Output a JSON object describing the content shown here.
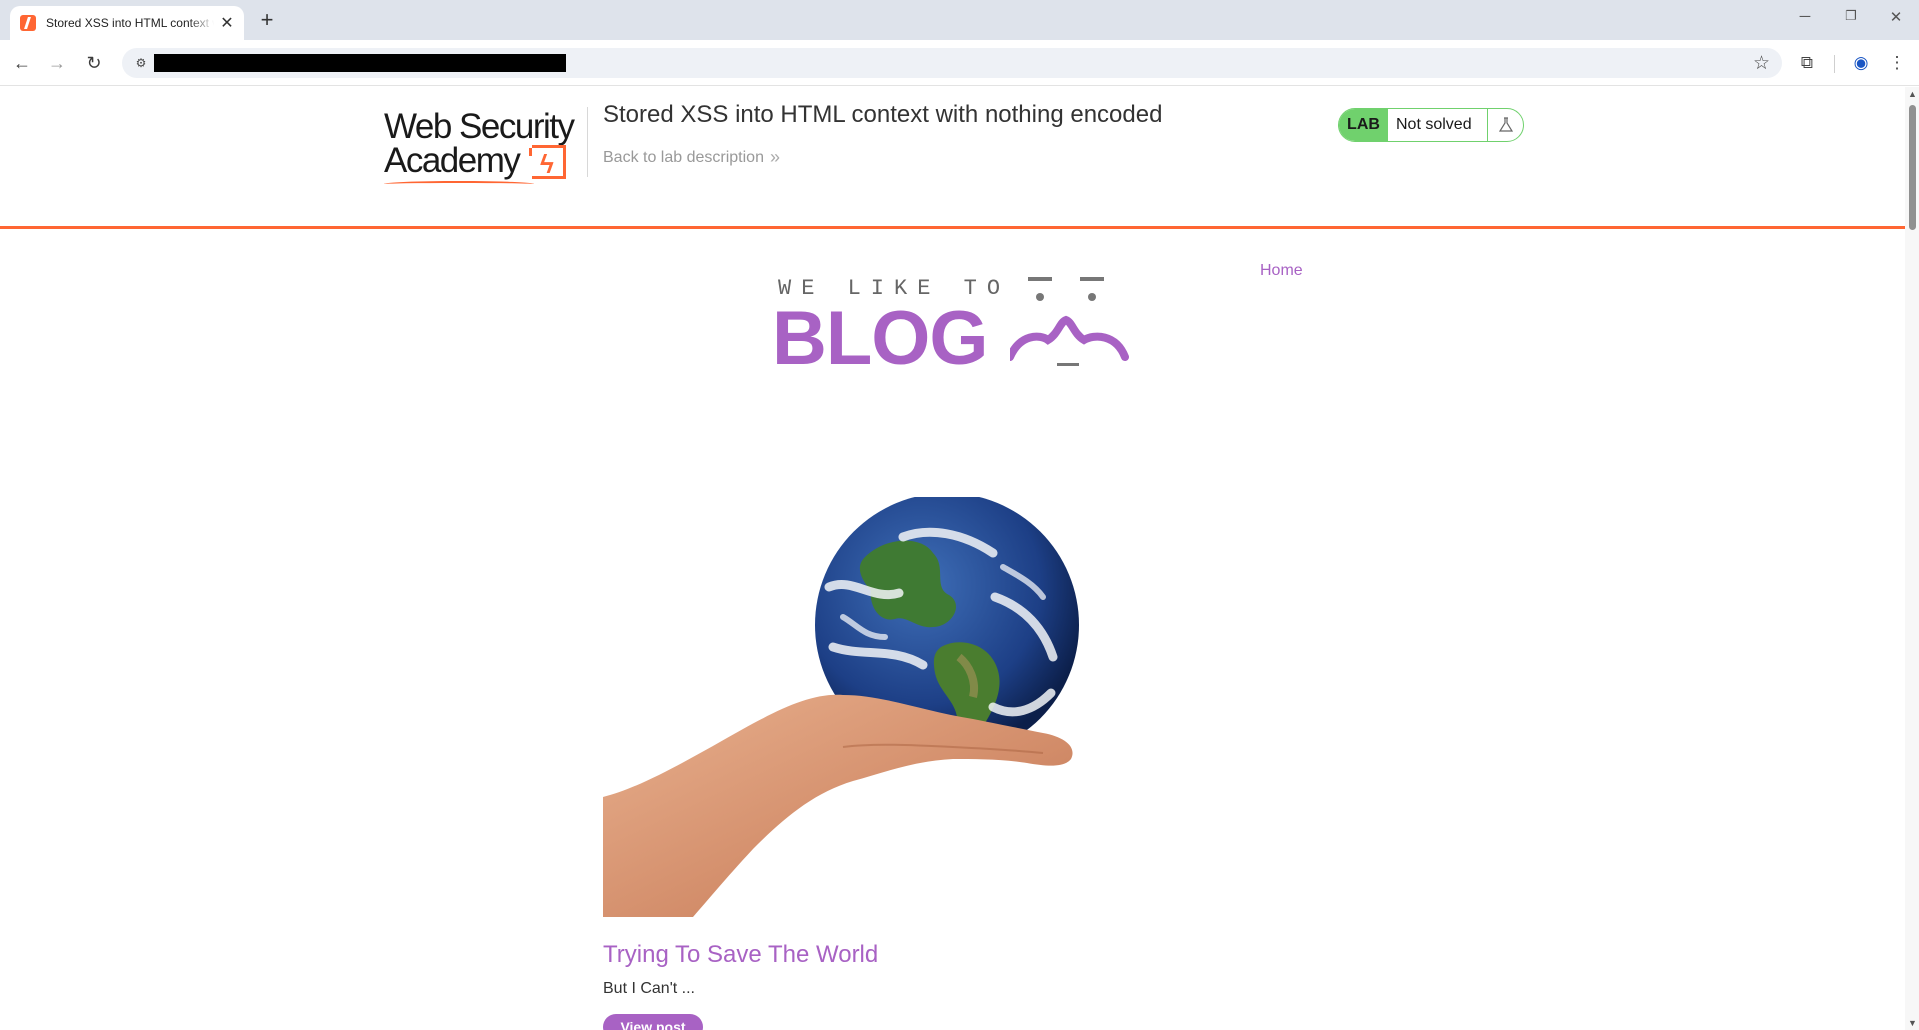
{
  "browser": {
    "tab_title": "Stored XSS into HTML context with nothing encoded",
    "tab_close": "✕",
    "new_tab": "+",
    "win_minimize": "─",
    "win_restore": "❐",
    "win_close": "✕",
    "back": "←",
    "forward": "→",
    "reload": "↻",
    "url_redacted": true
  },
  "lab": {
    "logo_line1": "Web Security",
    "logo_line2": "Academy",
    "title": "Stored XSS into HTML context with nothing encoded",
    "back_link": "Back to lab description",
    "badge": "LAB",
    "status": "Not solved",
    "status_color": "#70d16d"
  },
  "blog": {
    "nav_home": "Home",
    "logo_top": "WE LIKE TO",
    "logo_main": "BLOG",
    "accent": "#a862c4",
    "posts": [
      {
        "title": "Trying To Save The World",
        "summary": "But I Can't ...",
        "button": "View post"
      }
    ]
  },
  "colors": {
    "header_rule": "#ff6633"
  }
}
